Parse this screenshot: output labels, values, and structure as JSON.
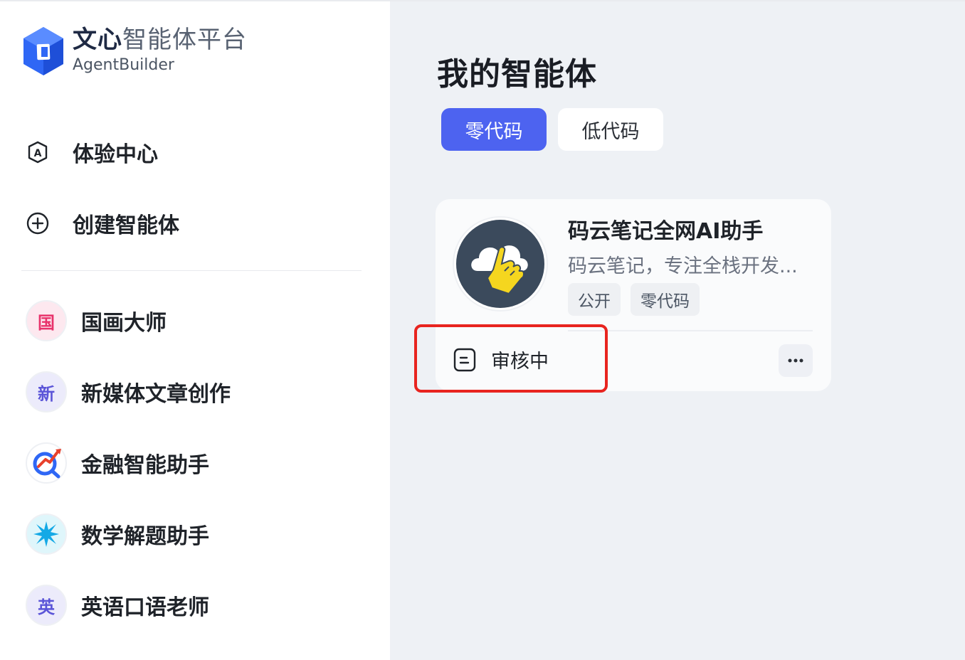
{
  "brand": {
    "title_bold": "文心",
    "title_rest": "智能体平台",
    "subtitle": "AgentBuilder",
    "color_primary": "#2f67f5"
  },
  "nav": [
    {
      "label": "体验中心",
      "icon": "letter-a-icon"
    },
    {
      "label": "创建智能体",
      "icon": "plus-circle-icon"
    }
  ],
  "agents": [
    {
      "label": "国画大师",
      "avatar_char": "国",
      "avatar_bg": "#fde8ef",
      "avatar_color": "#e8336b"
    },
    {
      "label": "新媒体文章创作",
      "avatar_char": "新",
      "avatar_bg": "#ecebfb",
      "avatar_color": "#5b55d8"
    },
    {
      "label": "金融智能助手",
      "avatar_char": "",
      "avatar_icon": "finance-chart-icon"
    },
    {
      "label": "数学解题助手",
      "avatar_char": "",
      "avatar_icon": "sparkle-burst-icon"
    },
    {
      "label": "英语口语老师",
      "avatar_char": "英",
      "avatar_bg": "#ecebfb",
      "avatar_color": "#5b55d8"
    }
  ],
  "main": {
    "title": "我的智能体",
    "tabs": [
      {
        "label": "零代码",
        "active": true
      },
      {
        "label": "低代码",
        "active": false
      }
    ],
    "card": {
      "title": "码云笔记全网AI助手",
      "description": "码云笔记，专注全栈开发...",
      "tags": [
        "公开",
        "零代码"
      ],
      "status": "审核中",
      "avatar_icon": "cloud-hand-icon"
    }
  },
  "colors": {
    "tab_active": "#4d63f0",
    "highlight": "#e8241f"
  }
}
